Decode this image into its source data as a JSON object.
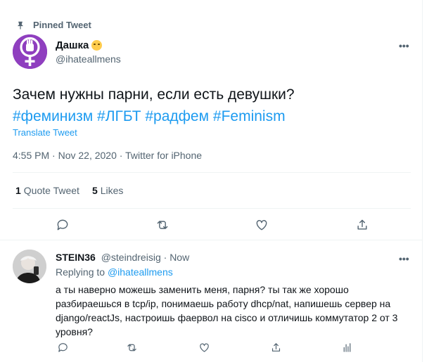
{
  "pinned": {
    "label": "Pinned Tweet"
  },
  "tweet": {
    "author_name": "Дашка",
    "author_emoji": "smiling-face-with-heart-eyes",
    "author_handle": "@ihateallmens",
    "text": "Зачем нужны парни, если есть девушки?",
    "hashtags": "#феминизм #ЛГБТ #радфем #Feminism",
    "translate_label": "Translate Tweet",
    "time": "4:55 PM",
    "date": "Nov 22, 2020",
    "source": "Twitter for iPhone",
    "meta_sep": "·",
    "quote_count": "1",
    "quote_label": "Quote Tweet",
    "likes_count": "5",
    "likes_label": "Likes"
  },
  "reply": {
    "name": "STEIN36",
    "handle": "@steindreisig",
    "sep": "·",
    "time": "Now",
    "replying_label": "Replying to",
    "replying_to": "@ihateallmens",
    "text": "а ты наверно можешь заменить меня, парня? ты так же хорошо разбираешься в tcp/ip, понимаешь работу dhcp/nat, напишешь сервер на django/reactJs, настроишь фаервол на cisco и отличишь коммутатор 2 от 3 уровня?"
  },
  "colors": {
    "accent": "#1d9bf0",
    "secondary_text": "#536471",
    "divider": "#eff3f4",
    "avatar_purple": "#8f3fbf"
  },
  "icons": [
    "pin-icon",
    "reply-icon",
    "retweet-icon",
    "like-icon",
    "share-icon",
    "analytics-icon",
    "more-icon"
  ]
}
